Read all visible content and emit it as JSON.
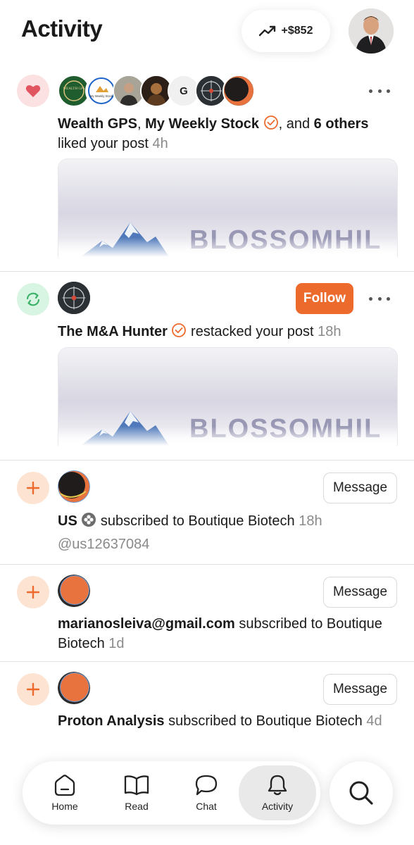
{
  "header": {
    "title": "Activity",
    "earnings": "+$852"
  },
  "items": [
    {
      "type": "like",
      "actor_1": "Wealth GPS",
      "sep_1": ", ",
      "actor_2": "My Weekly Stock",
      "mid": ", and ",
      "others_count": "6 others",
      "action": " liked your post ",
      "time": "4h",
      "preview_brand": "BLOSSOMHIL",
      "avatar_labels": [
        "WEALTH GPS",
        "My Weekly Stock",
        "",
        "",
        "G",
        "",
        ""
      ]
    },
    {
      "type": "restack",
      "actor": "The M&A Hunter",
      "action": " restacked your post ",
      "time": "18h",
      "follow_label": "Follow",
      "preview_brand": "BLOSSOMHIL"
    },
    {
      "type": "subscribe",
      "actor": "US",
      "action": " subscribed to Boutique Biotech ",
      "time": "18h",
      "handle": "@us12637084",
      "message_label": "Message"
    },
    {
      "type": "subscribe",
      "actor": "marianosleiva@gmail.com",
      "action": " subscribed to Boutique Biotech ",
      "time": "1d",
      "message_label": "Message"
    },
    {
      "type": "subscribe",
      "actor": "Proton Analysis",
      "action": " subscribed to Boutique Biotech ",
      "time": "4d",
      "message_label": "Message"
    }
  ],
  "nav": {
    "home": "Home",
    "read": "Read",
    "chat": "Chat",
    "activity": "Activity"
  },
  "colors": {
    "accent": "#ec6a2c",
    "like": "#e05560",
    "restack": "#3ab368",
    "subscribe": "#ec6a2c"
  }
}
